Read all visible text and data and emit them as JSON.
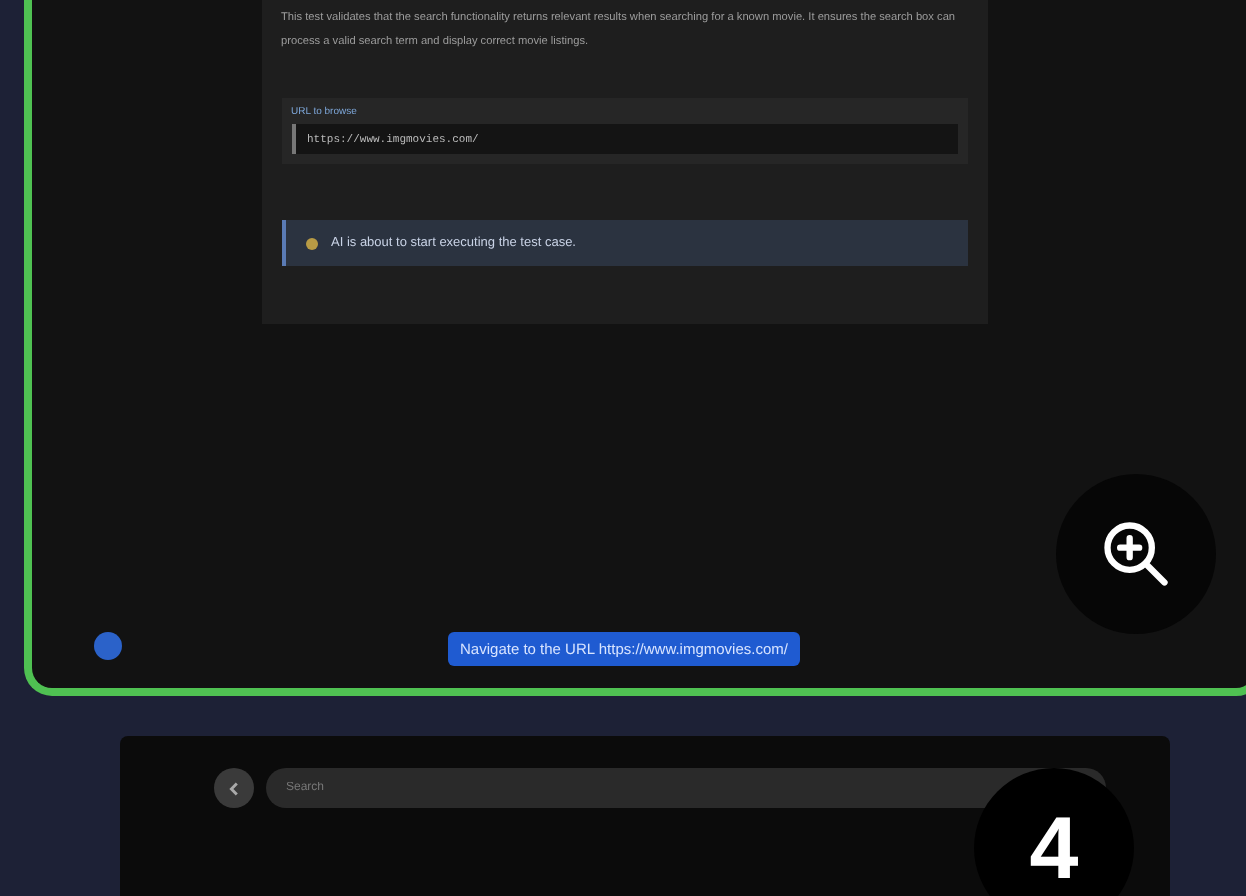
{
  "test_panel": {
    "description": "This test validates that the search functionality returns relevant results when searching for a known movie. It ensures the search box can process a valid search term and display correct movie listings.",
    "url_field": {
      "label": "URL to browse",
      "value": "https://www.imgmovies.com/"
    },
    "notice": "AI is about to start executing the test case."
  },
  "action_button": "Navigate to the URL https://www.imgmovies.com/",
  "browser": {
    "search": {
      "placeholder": "Search"
    }
  },
  "step_badge": "4"
}
